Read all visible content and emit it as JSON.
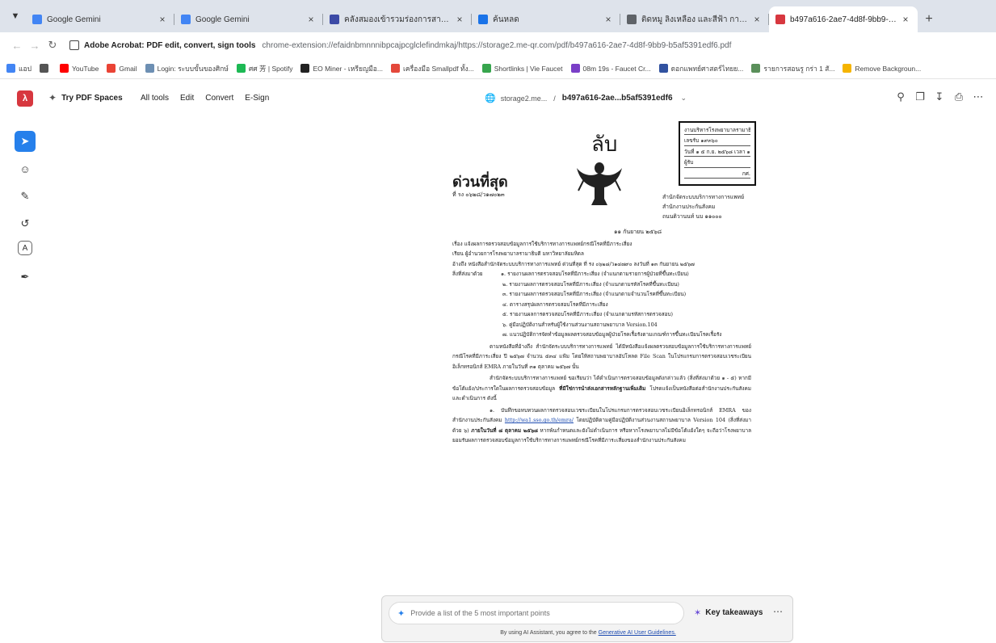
{
  "tabs": [
    {
      "title": "Google Gemini",
      "icon": "gemini-icon",
      "color": "#4285f4",
      "active": false
    },
    {
      "title": "Google Gemini",
      "icon": "gemini-icon",
      "color": "#4285f4",
      "active": false
    },
    {
      "title": "คลังสมองเข้ารวมร่องการสามชน์ไป",
      "icon": "doc-icon",
      "color": "#3c4aa6",
      "active": false
    },
    {
      "title": "ค้นหลด",
      "icon": "globe-icon",
      "color": "#1a73e8",
      "active": false
    },
    {
      "title": "ติดหมู ลิงเหลือง และสีฟ้า การ์ตูน น่ารัก",
      "icon": "image-icon",
      "color": "#5f6368",
      "active": false
    },
    {
      "title": "b497a616-2ae7-4d8f-9bb9-b5...",
      "icon": "acrobat-icon",
      "color": "#d7373f",
      "active": true
    }
  ],
  "address": {
    "site_name": "Adobe Acrobat: PDF edit, convert, sign tools",
    "url": "chrome-extension://efaidnbmnnnibpcajpcglclefindmkaj/https://storage2.me-qr.com/pdf/b497a616-2ae7-4d8f-9bb9-b5af5391edf6.pdf"
  },
  "bookmarks": [
    {
      "label": "แอป",
      "color": "#4285f4"
    },
    {
      "label": "",
      "color": "#555555"
    },
    {
      "label": "YouTube",
      "color": "#ff0000"
    },
    {
      "label": "Gmail",
      "color": "#ea4335"
    },
    {
      "label": "Login: ระบบขั้นของศิกษ์",
      "color": "#6d8fb3"
    },
    {
      "label": "ศศ 芳 | Spotify",
      "color": "#1db954"
    },
    {
      "label": "EO Miner - เหรียญมือ...",
      "color": "#222222"
    },
    {
      "label": "เครื่องมือ Smallpdf ทั้ง...",
      "color": "#e4483b"
    },
    {
      "label": "Shortlinks | Vie Faucet",
      "color": "#37a54d"
    },
    {
      "label": "08m 19s - Faucet Cr...",
      "color": "#7a3fc7"
    },
    {
      "label": "ดอกแพทย์ศาสตร์ไทยย...",
      "color": "#3152a0"
    },
    {
      "label": "รายการสอนรู กร่า 1 สั...",
      "color": "#5a8f5a"
    },
    {
      "label": "Remove Backgroun...",
      "color": "#f5b400"
    }
  ],
  "acrobat": {
    "try_spaces": "Try PDF Spaces",
    "menu": [
      "All tools",
      "Edit",
      "Convert",
      "E-Sign"
    ],
    "path_host": "storage2.me...",
    "path_sep": "/",
    "file_name": "b497a616-2ae...b5af5391edf6"
  },
  "tools": [
    "select-icon",
    "comment-icon",
    "pen-icon",
    "lasso-icon",
    "text-box-icon",
    "fill-sign-icon"
  ],
  "pdf": {
    "secret_label": "ลับ",
    "urgent_label": "ด่วนที่สุด",
    "doc_no": "ที่ รง ๐๖๒๘/ว๑๗๐๒๓",
    "stamp_lines": [
      "งานบริหารโรงพยาบาลรามาธิบดี",
      "เลขรับ ๑๙๓๖๐",
      "วันที่ ๑ ๕ ก.ย. ๒๕๖๘ เวลา ๑๔.๒๑น.",
      "ผู้รับ",
      "กศ."
    ],
    "sender_lines": [
      "สำนักจัดระบบบริการทางการแพทย์",
      "สำนักงานประกันสังคม",
      "ถนนติวานนท์ นบ ๑๑๐๐๐"
    ],
    "date": "๑๑ กันยายน ๒๕๖๘",
    "subject": "เรื่อง  แจ้งผลการตรวจสอบข้อมูลการใช้บริการทางการแพทย์กรณีโรคที่มีภาระเสี่ยง",
    "to": "เรียน  ผู้อำนวยการโรงพยาบาลรามาธิบดี มหาวิทยาลัยมหิดล",
    "ref": "อ้างถึง  หนังสือสำนักจัดระบบบริการทางการแพทย์ ด่วนที่สุด ที่ รง ๐๖๒๘/ว๑๔๗๙๐ ลงวันที่ ๑๓ กันยายน ๒๕๖๗",
    "enclosures_label": "สิ่งที่ส่งมาด้วย",
    "enclosures": [
      "๑. รายงานผลการตรวจสอบโรคที่มีภาระเสี่ยง (จำแนกตามรายการผู้ป่วยที่ขึ้นทะเบียน)",
      "๒. รายงานผลการตรวจสอบโรคที่มีภาระเสี่ยง (จำแนกตามรหัสโรคที่ขึ้นทะเบียน)",
      "๓. รายงานผลการตรวจสอบโรคที่มีภาระเสี่ยง (จำแนกตามจำนวนโรคที่ขึ้นทะเบียน)",
      "๔. ตารางสรุปผลการตรวจสอบโรคที่มีภาระเสี่ยง",
      "๕. รายงานผลการตรวจสอบโรคที่มีภาระเสี่ยง (จำแนกตามรหัสการตรวจสอบ)",
      "๖. คู่มือปฏิบัติงานสำหรับผู้ใช้งานส่วนงานสถานพยาบาล Version.104",
      "๗. แนวปฏิบัติการจัดทำข้อมูลผลตรวจสอบข้อมูลผู้ป่วยโรคเรื้อรังตามเกณฑ์การขึ้นทะเบียนโรคเรื้อรัง"
    ],
    "para1": "ตามหนังสือที่อ้างถึง สำนักจัดระบบบริการทางการแพทย์ ได้มีหนังสือแจ้งผลตรวจสอบข้อมูลการใช้บริการทางการแพทย์กรณีโรคที่มีภาระเสี่ยง ปี ๒๕๖๗ จำนวน ๕๓๔ แฟ้ม โดยให้สถานพยาบาลอัปโหลด File Scan ในโปรแกรมการตรวจสอบเวชระเบียนอิเล็กทรอนิกส์ EMRA ภายในวันที่ ๓๑ ตุลาคม ๒๕๖๗ นั้น",
    "para2_a": "สำนักจัดระบบบริการทางการแพทย์ ขอเรียนว่า ได้ดำเนินการตรวจสอบข้อมูลดังกล่าวแล้ว (สิ่งที่ส่งมาด้วย ๑ - ๕) หากมีข้อโต้แย้ง/ประการใดในผลการตรวจสอบข้อมูล",
    "para2_b": "ที่มีใช่การนำส่งเอกสารหลักฐานเพิ่มเติม",
    "para2_c": "โปรดแจ้งเป็นหนังสือต่อสำนักงานประกันสังคมและดำเนินการ ดังนี้",
    "para3_a": "๑. บันทึกขอทบทวนผลการตรวจสอบเวชระเบียนในโปรแกรมการตรวจสอบเวชระเบียนอิเล็กทรอนิกส์ EMRA ของสำนักงานประกันสังคม",
    "para3_link": "http://wa1.sso.go.th/emra/",
    "para3_b": "โดยปฏิบัติตามคู่มือปฏิบัติงานส่วนงานสถานพยาบาล Version 104 (สิ่งที่ส่งมาด้วย ๖)",
    "para3_bold": "ภายในวันที่ ๘ ตุลาคม ๒๕๖๘",
    "para3_c": "หากพ้นกำหนดและยังไม่ดำเนินการ หรือหากโรงพยาบาลไม่มีข้อโต้แย้งใดๆ จะถือว่าโรงพยาบาลยอมรับผลการตรวจสอบข้อมูลการใช้บริการทางการแพทย์กรณีโรคที่มีภาระเสี่ยงของสำนักงานประกันสังคม"
  },
  "ai": {
    "placeholder": "Provide a list of the 5 most important points",
    "key_takeaways": "Key takeaways",
    "note_prefix": "By using AI Assistant, you agree to the",
    "note_link": "Generative AI User Guidelines."
  }
}
